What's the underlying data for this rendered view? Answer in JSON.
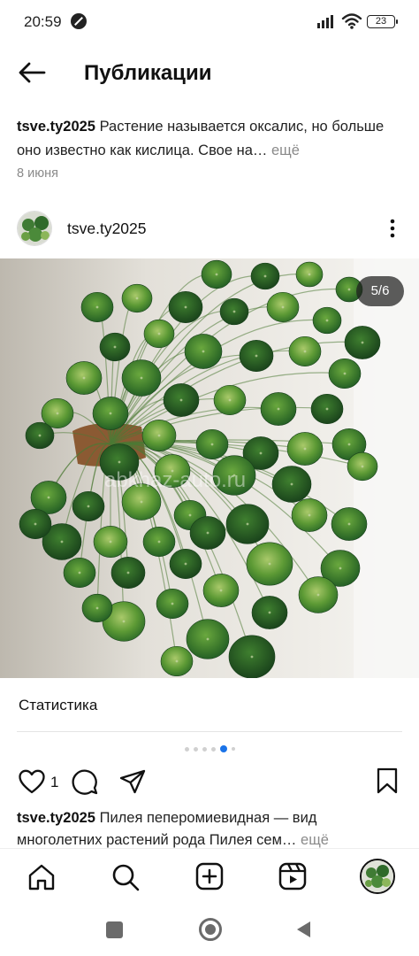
{
  "status_bar": {
    "time": "20:59",
    "battery": "23",
    "icons": [
      "do-not-disturb-icon",
      "signal-icon",
      "wifi-icon",
      "battery-icon"
    ]
  },
  "header": {
    "title": "Публикации",
    "back_icon": "arrow-left-icon"
  },
  "top_post": {
    "username": "tsve.ty2025",
    "caption": "Растение называется оксалис, но больше оно известно как кислица. Свое на…",
    "more": "ещё",
    "date": "8 июня"
  },
  "post": {
    "username": "tsve.ty2025",
    "menu_icon": "more-vertical-icon",
    "image_counter": "5/6",
    "image_subject": "pilea-peperomioides-plant",
    "watermark": "abkhaz-auto.ru",
    "stats_label": "Статистика",
    "carousel": {
      "total": 6,
      "current": 5
    },
    "likes": "1",
    "caption_username": "tsve.ty2025",
    "caption": "Пилея пеперомиевидная — вид многолетних растений рода Пилея сем…",
    "more": "ещё"
  },
  "bottom_nav": [
    "home-icon",
    "search-icon",
    "create-icon",
    "reels-icon",
    "profile-avatar"
  ],
  "colors": {
    "accent": "#1a73e8",
    "muted_text": "#8a8a8a",
    "leaf_dark": "#1f5a24",
    "leaf_light": "#6aa83e"
  }
}
